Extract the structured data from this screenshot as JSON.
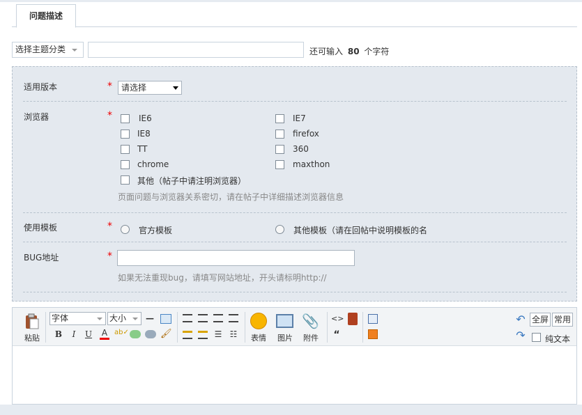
{
  "tabs": [
    {
      "label": "问题描述"
    }
  ],
  "subject": {
    "category_select": "选择主题分类",
    "remaining_prefix": "还可输入",
    "remaining_count": "80",
    "remaining_suffix": "个字符"
  },
  "form": {
    "version": {
      "label": "适用版本",
      "required": "*",
      "select_value": "请选择"
    },
    "browser": {
      "label": "浏览器",
      "required": "*",
      "options": [
        "IE6",
        "IE7",
        "IE8",
        "firefox",
        "TT",
        "360",
        "chrome",
        "maxthon",
        "其他（帖子中请注明浏览器）"
      ],
      "hint": "页面问题与浏览器关系密切，请在帖子中详细描述浏览器信息"
    },
    "template": {
      "label": "使用模板",
      "required": "*",
      "options": [
        "官方模板",
        "其他模板（请在回帖中说明模板的名"
      ]
    },
    "bug_url": {
      "label": "BUG地址",
      "required": "*",
      "hint": "如果无法重现bug，请填写网站地址，开头请标明http://"
    }
  },
  "editor": {
    "paste_label": "粘贴",
    "font_select": "字体",
    "size_select": "大小",
    "emoticon_label": "表情",
    "image_label": "图片",
    "attachment_label": "附件",
    "fullscreen_label": "全屏",
    "common_label": "常用",
    "plaintext_label": "纯文本",
    "bold": "B",
    "italic": "I",
    "underline": "U",
    "font_color": "A",
    "quote": "“",
    "code": "<>"
  },
  "colors": {
    "required_star": "#e00000",
    "panel_bg": "#e4e9ef",
    "hint_text": "#888888"
  }
}
